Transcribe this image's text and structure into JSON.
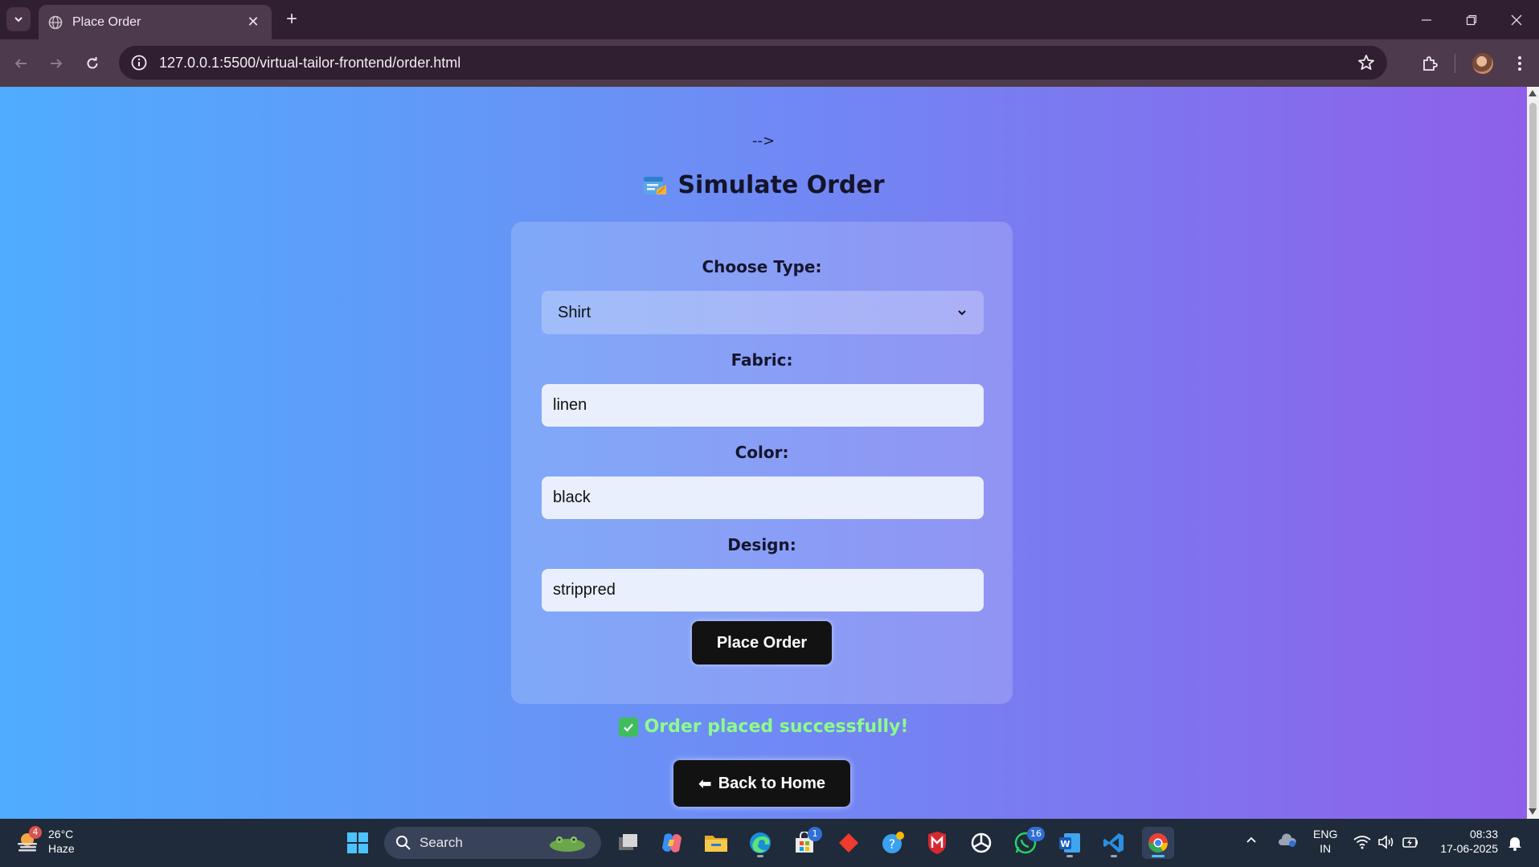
{
  "browser": {
    "tab_title": "Place Order",
    "url": "127.0.0.1:5500/virtual-tailor-frontend/order.html"
  },
  "page": {
    "stray_text": "-->",
    "title": "Simulate Order",
    "form": {
      "type_label": "Choose Type:",
      "type_value": "Shirt",
      "fabric_label": "Fabric:",
      "fabric_value": "linen",
      "color_label": "Color:",
      "color_value": "black",
      "design_label": "Design:",
      "design_value": "strippred",
      "submit_label": "Place Order"
    },
    "success_message": "Order placed successfully!",
    "back_label": "Back to Home",
    "back_arrow": "⬅"
  },
  "taskbar": {
    "weather_temp": "26°C",
    "weather_desc": "Haze",
    "weather_badge": "4",
    "search_label": "Search",
    "store_badge": "1",
    "whatsapp_badge": "16",
    "lang_top": "ENG",
    "lang_bottom": "IN",
    "time": "08:33",
    "date": "17-06-2025"
  }
}
